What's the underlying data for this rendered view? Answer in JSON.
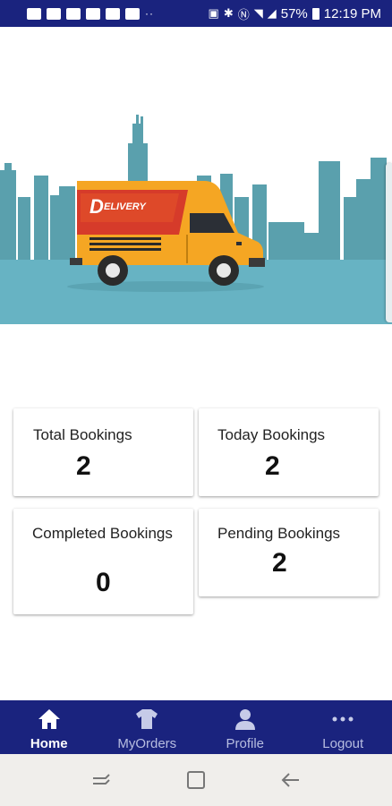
{
  "status_bar": {
    "battery_percent": "57%",
    "time": "12:19 PM",
    "background_color": "#1a237e"
  },
  "banner": {
    "van_brand_text": "ELIVERY",
    "van_logo_letter": "D"
  },
  "stats": {
    "total": {
      "label": "Total Bookings",
      "value": "2"
    },
    "today": {
      "label": "Today Bookings",
      "value": "2"
    },
    "completed": {
      "label": "Completed Bookings",
      "value": "0"
    },
    "pending": {
      "label": "Pending Bookings",
      "value": "2"
    }
  },
  "bottom_nav": {
    "background_color": "#1a237e",
    "items": [
      {
        "label": "Home",
        "icon": "home-icon",
        "active": true
      },
      {
        "label": "MyOrders",
        "icon": "shirt-icon",
        "active": false
      },
      {
        "label": "Profile",
        "icon": "person-icon",
        "active": false
      },
      {
        "label": "Logout",
        "icon": "more-dots-icon",
        "active": false
      }
    ]
  },
  "system_nav": {
    "buttons": [
      "recent-apps-icon",
      "home-square-icon",
      "back-arrow-icon"
    ]
  }
}
